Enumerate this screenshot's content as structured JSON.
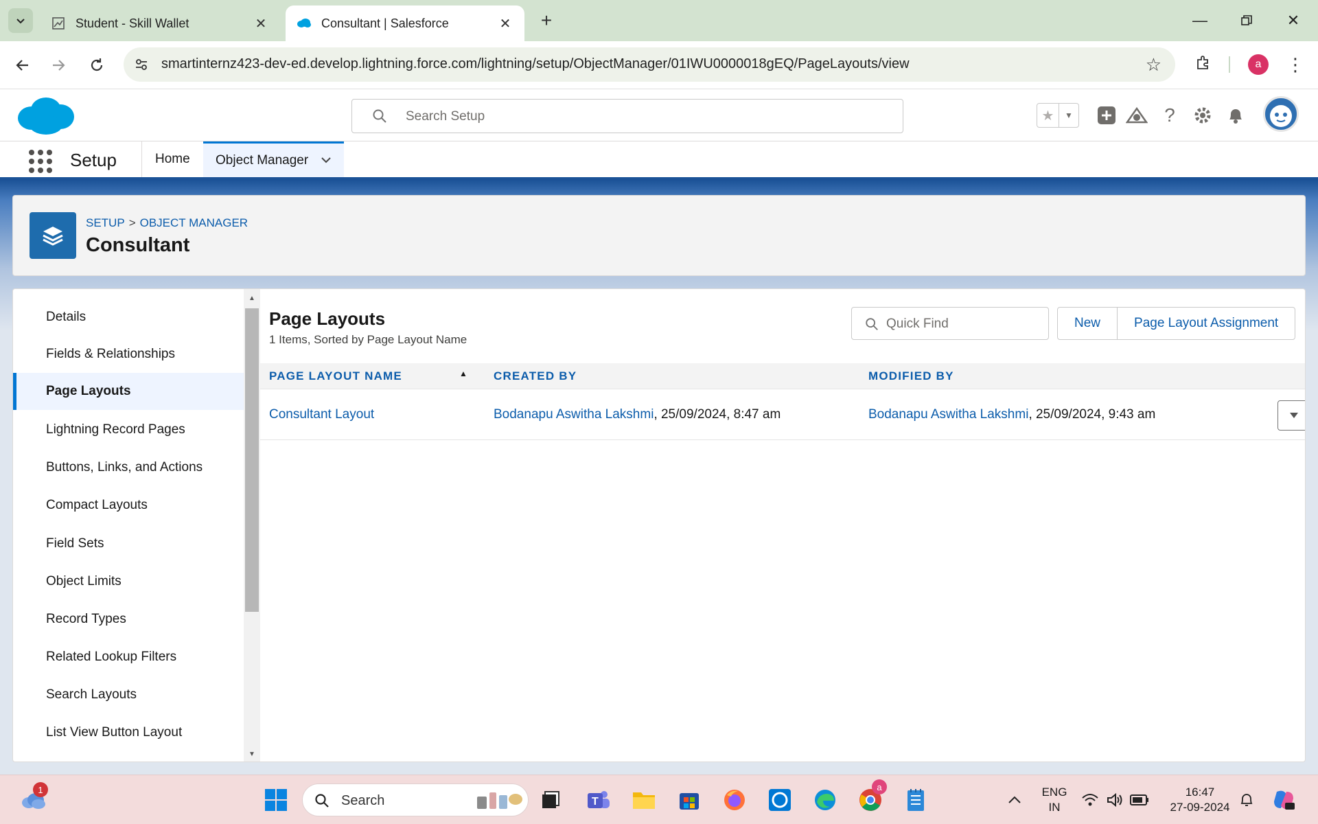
{
  "browser": {
    "tabs": [
      {
        "title": "Student - Skill Wallet",
        "active": false
      },
      {
        "title": "Consultant | Salesforce",
        "active": true
      }
    ],
    "url": "smartinternz423-dev-ed.develop.lightning.force.com/lightning/setup/ObjectManager/01IWU0000018gEQ/PageLayouts/view",
    "profile_initial": "a"
  },
  "header": {
    "search_placeholder": "Search Setup"
  },
  "nav": {
    "app_name": "Setup",
    "items": [
      {
        "label": "Home"
      },
      {
        "label": "Object Manager"
      }
    ]
  },
  "object_header": {
    "breadcrumb": [
      "SETUP",
      "OBJECT MANAGER"
    ],
    "breadcrumb_separator": ">",
    "title": "Consultant"
  },
  "sidebar": {
    "items": [
      {
        "label": "Details"
      },
      {
        "label": "Fields & Relationships"
      },
      {
        "label": "Page Layouts"
      },
      {
        "label": "Lightning Record Pages"
      },
      {
        "label": "Buttons, Links, and Actions"
      },
      {
        "label": "Compact Layouts"
      },
      {
        "label": "Field Sets"
      },
      {
        "label": "Object Limits"
      },
      {
        "label": "Record Types"
      },
      {
        "label": "Related Lookup Filters"
      },
      {
        "label": "Search Layouts"
      },
      {
        "label": "List View Button Layout"
      }
    ],
    "active_index": 2
  },
  "main": {
    "title": "Page Layouts",
    "subtitle": "1 Items, Sorted by Page Layout Name",
    "quick_find_placeholder": "Quick Find",
    "buttons": {
      "new": "New",
      "assignment": "Page Layout Assignment"
    },
    "columns": [
      "PAGE LAYOUT NAME",
      "CREATED BY",
      "MODIFIED BY"
    ],
    "rows": [
      {
        "name": "Consultant Layout",
        "created_by": "Bodanapu Aswitha Lakshmi",
        "created_at": ", 25/09/2024, 8:47 am",
        "modified_by": "Bodanapu Aswitha Lakshmi",
        "modified_at": ", 25/09/2024, 9:43 am"
      }
    ]
  },
  "taskbar": {
    "search_placeholder": "Search",
    "weather_badge": "1",
    "lang_line1": "ENG",
    "lang_line2": "IN",
    "time": "16:47",
    "date": "27-09-2024"
  },
  "colors": {
    "brand_blue": "#0176d3",
    "link_blue": "#0b5cab",
    "nav_bar": "#1b5297",
    "object_icon": "#1e6cad"
  }
}
